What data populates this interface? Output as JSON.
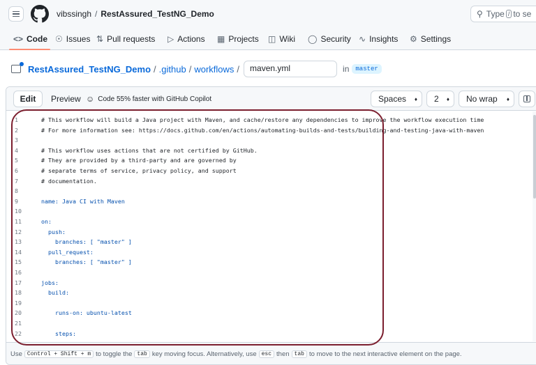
{
  "header": {
    "owner": "vibssingh",
    "separator": "/",
    "repo": "RestAssured_TestNG_Demo",
    "search_placeholder_before": "Type",
    "search_key": "/",
    "search_placeholder_after": "to se"
  },
  "repo_nav": {
    "tabs": [
      {
        "label": "Code",
        "icon": "code-icon",
        "active": true
      },
      {
        "label": "Issues",
        "icon": "issue-opened-icon"
      },
      {
        "label": "Pull requests",
        "icon": "git-pull-request-icon"
      },
      {
        "label": "Actions",
        "icon": "play-icon"
      },
      {
        "label": "Projects",
        "icon": "table-icon"
      },
      {
        "label": "Wiki",
        "icon": "book-icon"
      },
      {
        "label": "Security",
        "icon": "shield-icon"
      },
      {
        "label": "Insights",
        "icon": "graph-icon"
      },
      {
        "label": "Settings",
        "icon": "gear-icon"
      }
    ]
  },
  "file_breadcrumb": {
    "repo": "RestAssured_TestNG_Demo",
    "sep": "/",
    "dir1": ".github",
    "dir2": "workflows",
    "filename": "maven.yml",
    "in_label": "in",
    "branch": "master"
  },
  "editor": {
    "edit_tab": "Edit",
    "preview_tab": "Preview",
    "copilot_note": "Code 55% faster with GitHub Copilot",
    "indent_mode": "Spaces",
    "indent_size": "2",
    "wrap_mode": "No wrap",
    "lines": [
      {
        "n": "1",
        "text": "# This workflow will build a Java project with Maven, and cache/restore any dependencies to improve the workflow execution time",
        "type": "comment"
      },
      {
        "n": "2",
        "text": "# For more information see: https://docs.github.com/en/actions/automating-builds-and-tests/building-and-testing-java-with-maven",
        "type": "comment"
      },
      {
        "n": "3",
        "text": "",
        "type": "plain"
      },
      {
        "n": "4",
        "text": "# This workflow uses actions that are not certified by GitHub.",
        "type": "comment"
      },
      {
        "n": "5",
        "text": "# They are provided by a third-party and are governed by",
        "type": "comment"
      },
      {
        "n": "6",
        "text": "# separate terms of service, privacy policy, and support",
        "type": "comment"
      },
      {
        "n": "7",
        "text": "# documentation.",
        "type": "comment"
      },
      {
        "n": "8",
        "text": "",
        "type": "plain"
      },
      {
        "n": "9",
        "text": "name: Java CI with Maven",
        "type": "key"
      },
      {
        "n": "10",
        "text": "",
        "type": "plain"
      },
      {
        "n": "11",
        "text": "on:",
        "type": "key"
      },
      {
        "n": "12",
        "text": "  push:",
        "type": "key"
      },
      {
        "n": "13",
        "text": "    branches: [ \"master\" ]",
        "type": "key"
      },
      {
        "n": "14",
        "text": "  pull_request:",
        "type": "key"
      },
      {
        "n": "15",
        "text": "    branches: [ \"master\" ]",
        "type": "key"
      },
      {
        "n": "16",
        "text": "",
        "type": "plain"
      },
      {
        "n": "17",
        "text": "jobs:",
        "type": "key"
      },
      {
        "n": "18",
        "text": "  build:",
        "type": "key"
      },
      {
        "n": "19",
        "text": "",
        "type": "plain"
      },
      {
        "n": "20",
        "text": "    runs-on: ubuntu-latest",
        "type": "key"
      },
      {
        "n": "21",
        "text": "",
        "type": "plain"
      },
      {
        "n": "22",
        "text": "    steps:",
        "type": "key"
      }
    ],
    "hint": {
      "use": "Use",
      "shortcut": "Control + Shift + m",
      "toggle": "to toggle the",
      "tab_key": "tab",
      "rest1": "key moving focus. Alternatively, use",
      "esc_key": "esc",
      "then": "then",
      "tab_key2": "tab",
      "rest2": "to move to the next interactive element on the page."
    }
  },
  "colors": {
    "accent_underline": "#fd8c73",
    "link": "#0969da",
    "annotation": "#7b1e2e"
  }
}
